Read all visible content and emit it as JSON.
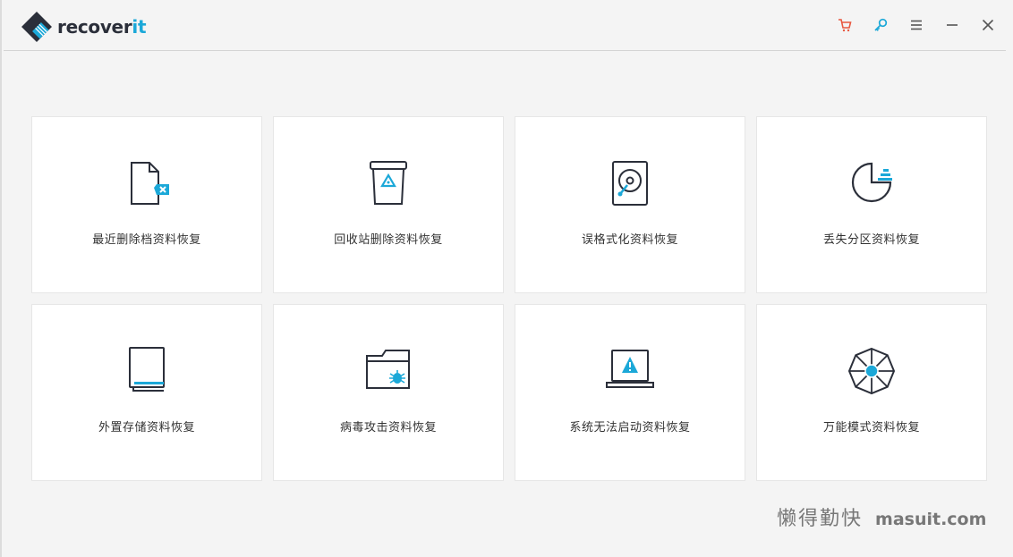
{
  "app": {
    "brand_prefix": "recover",
    "brand_suffix": "it"
  },
  "titlebar": {
    "icons": [
      "cart-icon",
      "key-icon",
      "menu-icon",
      "minimize-icon",
      "close-icon"
    ],
    "colors": {
      "cart": "#e8573f",
      "key": "#1ba8d8",
      "neutral": "#555555"
    }
  },
  "cards": [
    {
      "label": "最近删除档资料恢复",
      "icon": "deleted-file-icon"
    },
    {
      "label": "回收站删除资料恢复",
      "icon": "recycle-bin-icon"
    },
    {
      "label": "误格式化资料恢复",
      "icon": "hard-drive-icon"
    },
    {
      "label": "丢失分区资料恢复",
      "icon": "partition-icon"
    },
    {
      "label": "外置存储资料恢复",
      "icon": "external-device-icon"
    },
    {
      "label": "病毒攻击资料恢复",
      "icon": "virus-folder-icon"
    },
    {
      "label": "系统无法启动资料恢复",
      "icon": "crashed-computer-icon"
    },
    {
      "label": "万能模式资料恢复",
      "icon": "all-around-icon"
    }
  ],
  "watermark": {
    "cn": "懒得勤快",
    "en": "masuit.com"
  },
  "colors": {
    "accent": "#1ba8d8",
    "icon_dark": "#2b2f3a",
    "card_bg": "#ffffff",
    "window_bg": "#f4f4f4"
  }
}
